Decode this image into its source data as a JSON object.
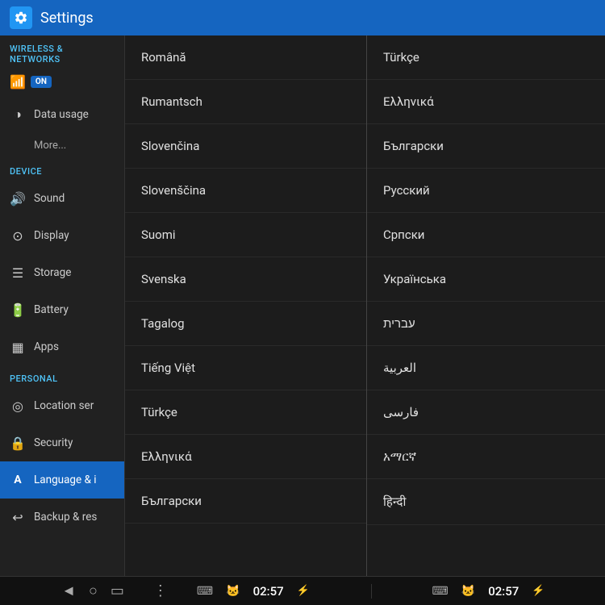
{
  "titleBar": {
    "title": "Settings",
    "iconChar": "⚙"
  },
  "sidebar": {
    "sections": [
      {
        "header": "WIRELESS & NETWORKS",
        "items": [
          {
            "id": "wifi",
            "label": "",
            "icon": "📶",
            "hasToggle": true,
            "toggle": "ON"
          },
          {
            "id": "data-usage",
            "label": "Data usage",
            "icon": "◑"
          },
          {
            "id": "more",
            "label": "More...",
            "icon": ""
          }
        ]
      },
      {
        "header": "DEVICE",
        "items": [
          {
            "id": "sound",
            "label": "Sound",
            "icon": "🔊"
          },
          {
            "id": "display",
            "label": "Display",
            "icon": "⊙"
          },
          {
            "id": "storage",
            "label": "Storage",
            "icon": "☰"
          },
          {
            "id": "battery",
            "label": "Battery",
            "icon": "🔋"
          },
          {
            "id": "apps",
            "label": "Apps",
            "icon": "▦"
          }
        ]
      },
      {
        "header": "PERSONAL",
        "items": [
          {
            "id": "location",
            "label": "Location ser",
            "icon": "◎"
          },
          {
            "id": "security",
            "label": "Security",
            "icon": "🔒"
          },
          {
            "id": "language",
            "label": "Language & i",
            "icon": "A",
            "active": true
          },
          {
            "id": "backup",
            "label": "Backup & res",
            "icon": "↩"
          }
        ]
      }
    ]
  },
  "middlePanel": {
    "languages": [
      "Română",
      "Rumantsch",
      "Slovenčina",
      "Slovenščina",
      "Suomi",
      "Svenska",
      "Tagalog",
      "Tiếng Việt",
      "Türkçe",
      "Ελληνικά",
      "Български"
    ]
  },
  "rightPanel": {
    "languages": [
      "Türkçe",
      "Ελληνικά",
      "Български",
      "Русский",
      "Српски",
      "Українська",
      "עברית",
      "العربية",
      "فارسی",
      "አማርኛ",
      "हिन्दी"
    ]
  },
  "statusBar": {
    "leftNav": [
      "◄",
      "○",
      "▭"
    ],
    "leftMiddle": "⋮",
    "leftStatusIcons": [
      "⌨",
      "🐱"
    ],
    "time": "02:57",
    "rightStatusIcons": [
      "⌨",
      "🐱"
    ],
    "rightTime": "02:57"
  }
}
